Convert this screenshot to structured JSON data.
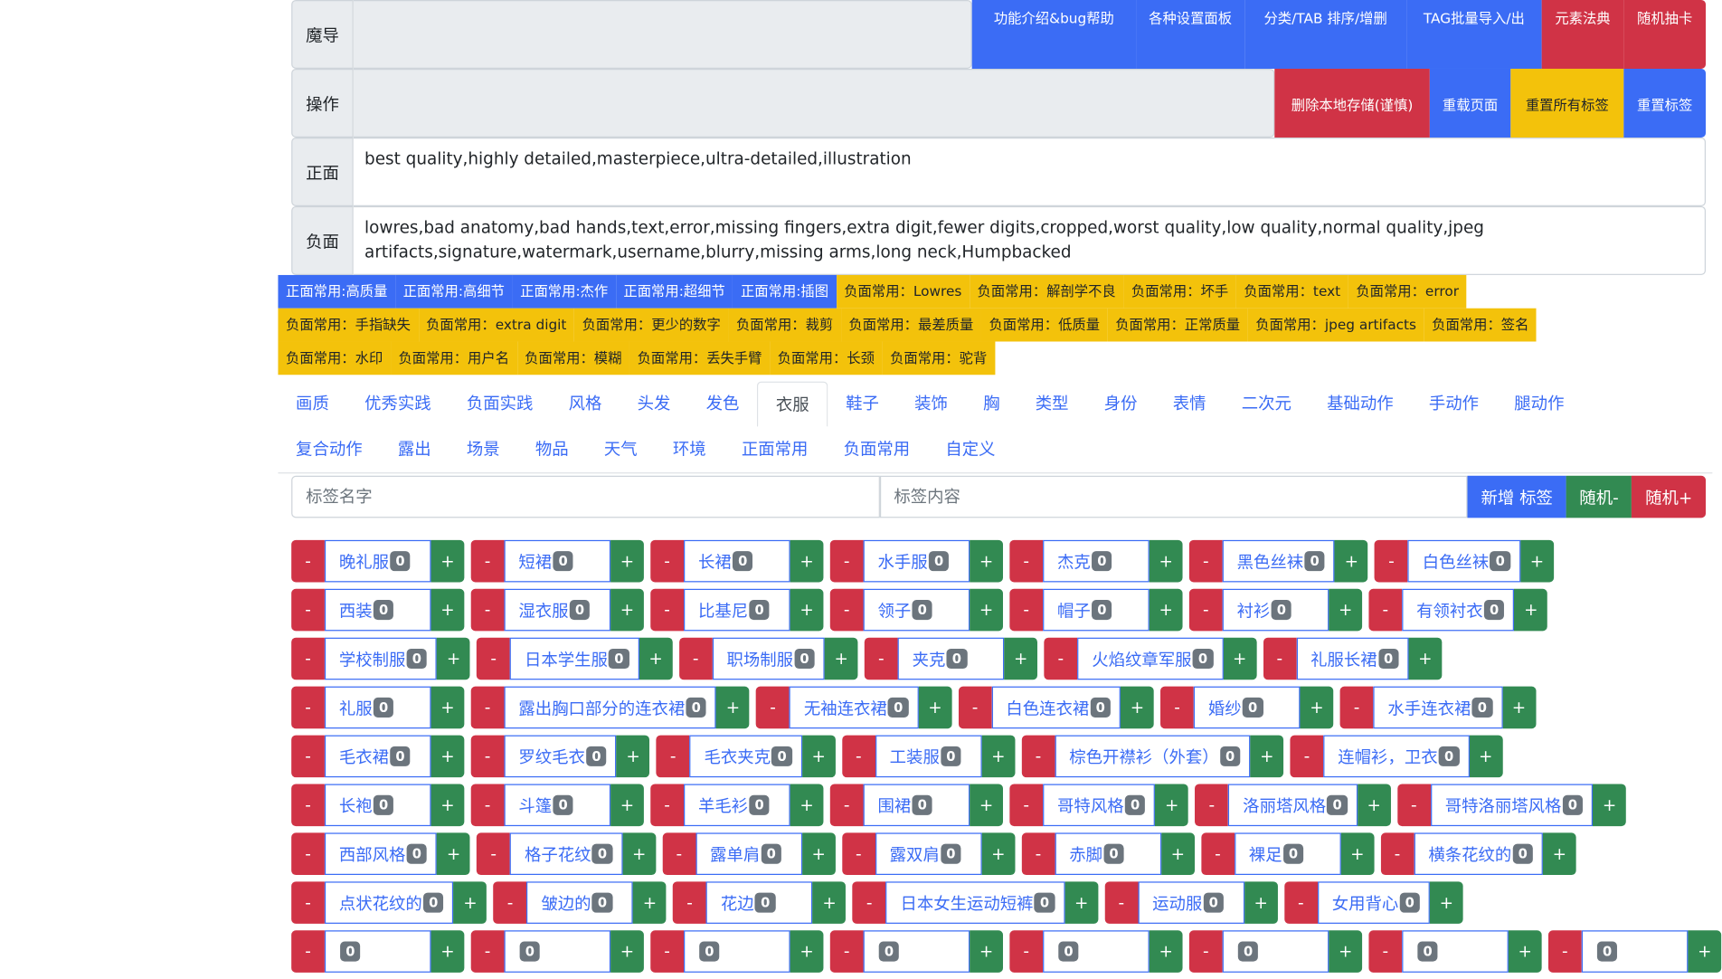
{
  "top_buttons": [
    "功能介绍&bug帮助",
    "各种设置面板",
    "分类/TAB 排序/增删",
    "TAG批量导入/出",
    "元素法典",
    "随机抽卡"
  ],
  "op_buttons": [
    "删除本地存储(谨慎)",
    "重载页面",
    "重置所有标签",
    "重置标签"
  ],
  "rows": {
    "magic_label": "魔导",
    "op_label": "操作",
    "pos_label": "正面",
    "pos_text": "best quality,highly detailed,masterpiece,ultra-detailed,illustration",
    "neg_label": "负面",
    "neg_text": "lowres,bad anatomy,bad hands,text,error,missing fingers,extra digit,fewer digits,cropped,worst quality,low quality,normal quality,jpeg artifacts,signature,watermark,username,blurry,missing arms,long neck,Humpbacked"
  },
  "chips": [
    [
      "正面常用:高质量",
      "正面常用:高细节",
      "正面常用:杰作",
      "正面常用:超细节",
      "正面常用:插图",
      "负面常用：Lowres",
      "负面常用：解剖学不良",
      "负面常用：坏手",
      "负面常用：text",
      "负面常用：error"
    ],
    [
      "负面常用：手指缺失",
      "负面常用：extra digit",
      "负面常用：更少的数字",
      "负面常用：裁剪",
      "负面常用：最差质量",
      "负面常用：低质量",
      "负面常用：正常质量",
      "负面常用：jpeg artifacts",
      "负面常用：签名"
    ],
    [
      "负面常用：水印",
      "负面常用：用户名",
      "负面常用：模糊",
      "负面常用：丢失手臂",
      "负面常用：长颈",
      "负面常用：驼背"
    ]
  ],
  "tabs": [
    [
      "画质",
      "优秀实践",
      "负面实践",
      "风格",
      "头发",
      "发色",
      "衣服",
      "鞋子",
      "装饰",
      "胸",
      "类型",
      "身份",
      "表情",
      "二次元",
      "基础动作",
      "手动作",
      "腿动作"
    ],
    [
      "复合动作",
      "露出",
      "场景",
      "物品",
      "天气",
      "环境",
      "正面常用",
      "负面常用",
      "自定义"
    ]
  ],
  "active_tab": "衣服",
  "inputs": {
    "name_placeholder": "标签名字",
    "content_placeholder": "标签内容"
  },
  "input_buttons": {
    "add": "新增 标签",
    "rand_minus": "随机-",
    "rand_plus": "随机+"
  },
  "tag_rows": [
    [
      "晚礼服",
      "短裙",
      "长裙",
      "水手服",
      "杰克",
      "黑色丝袜",
      "白色丝袜"
    ],
    [
      "西装",
      "湿衣服",
      "比基尼",
      "领子",
      "帽子",
      "衬衫",
      "有领衬衣"
    ],
    [
      "学校制服",
      "日本学生服",
      "职场制服",
      "夹克",
      "火焰纹章军服",
      "礼服长裙"
    ],
    [
      "礼服",
      "露出胸口部分的连衣裙",
      "无袖连衣裙",
      "白色连衣裙",
      "婚纱",
      "水手连衣裙"
    ],
    [
      "毛衣裙",
      "罗纹毛衣",
      "毛衣夹克",
      "工装服",
      "棕色开襟衫（外套）",
      "连帽衫，卫衣"
    ],
    [
      "长袍",
      "斗篷",
      "羊毛衫",
      "围裙",
      "哥特风格",
      "洛丽塔风格",
      "哥特洛丽塔风格"
    ],
    [
      "西部风格",
      "格子花纹",
      "露单肩",
      "露双肩",
      "赤脚",
      "裸足",
      "横条花纹的"
    ],
    [
      "点状花纹的",
      "皱边的",
      "花边",
      "日本女生运动短裤",
      "运动服",
      "女用背心"
    ],
    [
      "",
      "",
      "",
      "",
      "",
      "",
      "",
      ""
    ]
  ],
  "tag_count": "0",
  "minus": "-",
  "plus": "+"
}
